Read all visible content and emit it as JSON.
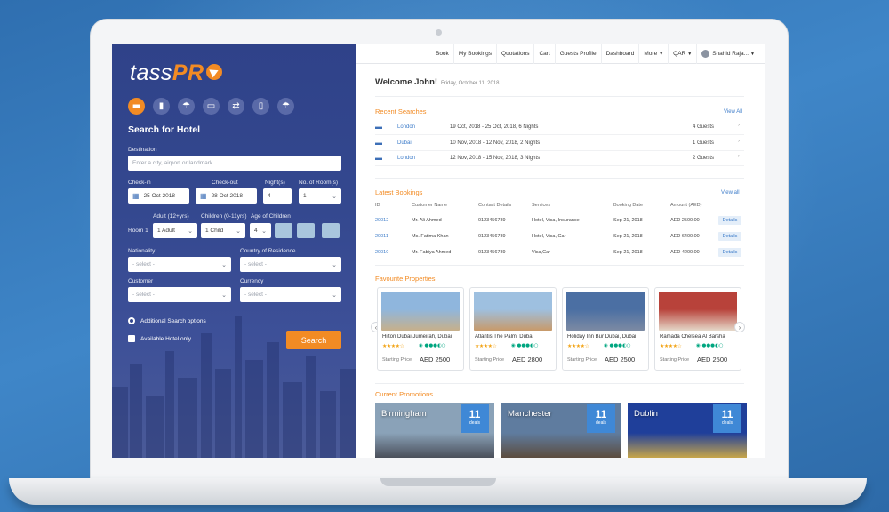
{
  "brand": {
    "logo_text": "tass",
    "logo_accent": "PR",
    "accent_color": "#f28b24",
    "primary_color": "#34488f"
  },
  "services": [
    {
      "icon": "hotel-icon",
      "glyph": "▬",
      "active": true
    },
    {
      "icon": "flight-icon",
      "glyph": "▮",
      "active": false
    },
    {
      "icon": "holiday-icon",
      "glyph": "☂",
      "active": false
    },
    {
      "icon": "car-icon",
      "glyph": "▭",
      "active": false
    },
    {
      "icon": "transfer-icon",
      "glyph": "⇄",
      "active": false
    },
    {
      "icon": "visa-icon",
      "glyph": "▯",
      "active": false
    },
    {
      "icon": "insurance-icon",
      "glyph": "☂",
      "active": false
    }
  ],
  "search": {
    "title": "Search for Hotel",
    "destination_label": "Destination",
    "destination_placeholder": "Enter a city, airport or landmark",
    "checkin_label": "Check-in",
    "checkin_value": "25 Oct 2018",
    "checkout_label": "Check-out",
    "checkout_value": "28 Oct 2018",
    "nights_label": "Night(s)",
    "nights_value": "4",
    "rooms_label": "No. of Room(s)",
    "rooms_value": "1",
    "adult_label": "Adult (12+yrs)",
    "children_label": "Children (0-11yrs)",
    "age_label": "Age of Children",
    "room_label": "Room 1",
    "adult_value": "1 Adult",
    "children_value": "1 Child",
    "age_value": "4",
    "nationality_label": "Nationality",
    "nationality_value": "- select -",
    "residence_label": "Country of Residence",
    "residence_value": "- select -",
    "customer_label": "Customer",
    "customer_value": "- select -",
    "currency_label": "Currency",
    "currency_value": "- select -",
    "additional_options": "Additional Search options",
    "available_only": "Available Hotel only",
    "button": "Search"
  },
  "nav": {
    "items": [
      "Book",
      "My Bookings",
      "Quotations",
      "Cart",
      "Guests Profile",
      "Dashboard"
    ],
    "more": "More",
    "currency": "QAR",
    "user": "Shahid Raja..."
  },
  "welcome": {
    "text": "Welcome John!",
    "date": "Friday, October 11, 2018"
  },
  "recent_searches": {
    "title": "Recent Searches",
    "view_all": "View All",
    "rows": [
      {
        "city": "London",
        "dates": "19 Oct, 2018 - 25 Oct, 2018, 6 Nights",
        "guests": "4 Guests"
      },
      {
        "city": "Dubai",
        "dates": "10 Nov, 2018 - 12 Nov, 2018, 2 Nights",
        "guests": "1 Guests"
      },
      {
        "city": "London",
        "dates": "12 Nov, 2018 - 15 Nov, 2018, 3 Nights",
        "guests": "2 Guests"
      }
    ]
  },
  "latest_bookings": {
    "title": "Latest Bookings",
    "view_all": "View all",
    "headers": [
      "ID",
      "Customer Name",
      "Contact Details",
      "Services",
      "Booking Date",
      "Amount (AED)"
    ],
    "rows": [
      {
        "id": "20012",
        "name": "Mr. Ali Ahmed",
        "contact": "0123456789",
        "services": "Hotel, Visa, Insurance",
        "date": "Sep 21, 2018",
        "amount": "AED 2500.00",
        "action": "Details"
      },
      {
        "id": "20011",
        "name": "Ms. Fatima Khan",
        "contact": "0123456789",
        "services": "Hotel, Visa, Car",
        "date": "Sep 21, 2018",
        "amount": "AED 6400.00",
        "action": "Details"
      },
      {
        "id": "20010",
        "name": "Mr. Fabiya Ahmed",
        "contact": "0123456789",
        "services": "Visa,Car",
        "date": "Sep 21, 2018",
        "amount": "AED 4200.00",
        "action": "Details"
      }
    ]
  },
  "favourites": {
    "title": "Favourite Properties",
    "price_label": "Starting Price",
    "items": [
      {
        "name": "Hilton Dubai Jumeirah, Dubai",
        "price": "AED 2500",
        "stars": 4,
        "rating": 3.5,
        "img_top": "#8fb6dd",
        "img_bottom": "#c7b08a"
      },
      {
        "name": "Atlantis The Palm, Dubai",
        "price": "AED 2800",
        "stars": 4,
        "rating": 3.5,
        "img_top": "#9ec0e0",
        "img_bottom": "#c89a6a"
      },
      {
        "name": "Holiday Inn Bur Dubai, Dubai",
        "price": "AED 2500",
        "stars": 4,
        "rating": 3.5,
        "img_top": "#4b6fa3",
        "img_bottom": "#7c8aa3"
      },
      {
        "name": "Ramada Chelsea Al Barsha",
        "price": "AED 2500",
        "stars": 4,
        "rating": 3.5,
        "img_top": "#b8423a",
        "img_bottom": "#e5d8c9"
      }
    ]
  },
  "promotions": {
    "title": "Current Promotions",
    "items": [
      {
        "city": "Birmingham",
        "count": "11",
        "unit": "deals",
        "sky": "#8aa2b8",
        "ground": "#4a4f5a"
      },
      {
        "city": "Manchester",
        "count": "11",
        "unit": "deals",
        "sky": "#5f7c9f",
        "ground": "#5c4c3e"
      },
      {
        "city": "Dublin",
        "count": "11",
        "unit": "deals",
        "sky": "#1f3f9a",
        "ground": "#c7a64a"
      }
    ]
  }
}
